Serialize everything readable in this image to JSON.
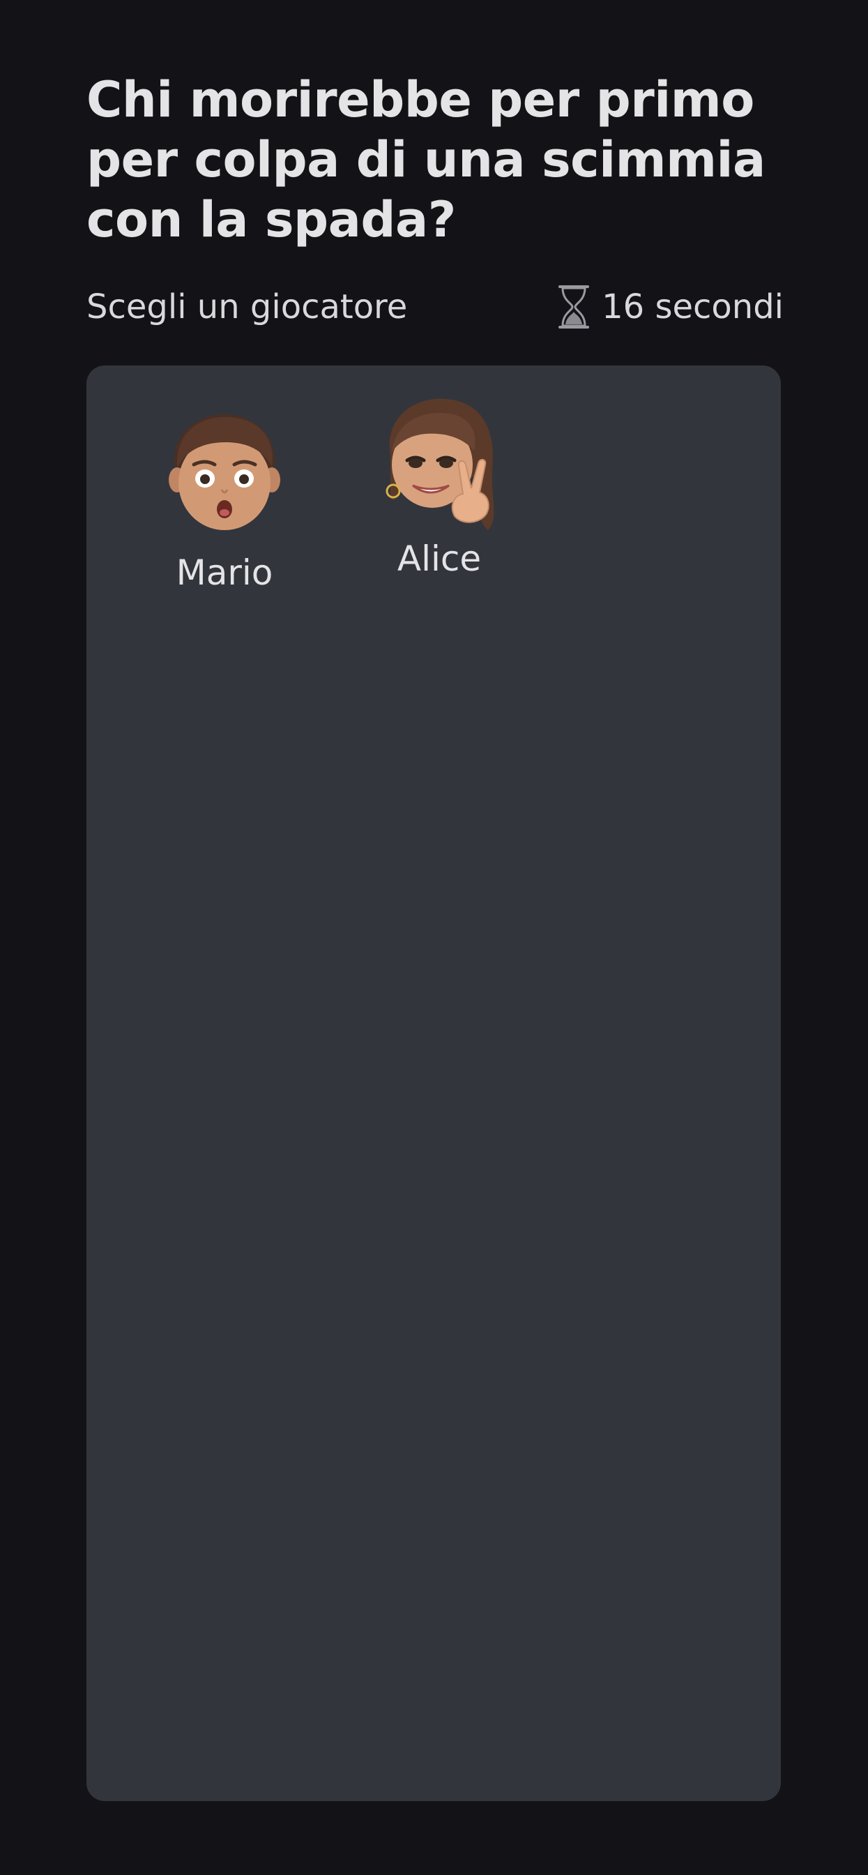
{
  "question": {
    "line1": "Chi morirebbe per primo",
    "line2": "per colpa di una scimmia",
    "line3": "con la spada?"
  },
  "prompt": "Scegli un giocatore",
  "timer": {
    "icon": "hourglass-icon",
    "label": "16 secondi"
  },
  "players": [
    {
      "name": "Mario",
      "avatar": "memoji-boy-surprised"
    },
    {
      "name": "Alice",
      "avatar": "memoji-girl-peace-sign"
    }
  ],
  "colors": {
    "background": "#131317",
    "panel": "#33353d",
    "text": "#e4e4e6"
  }
}
